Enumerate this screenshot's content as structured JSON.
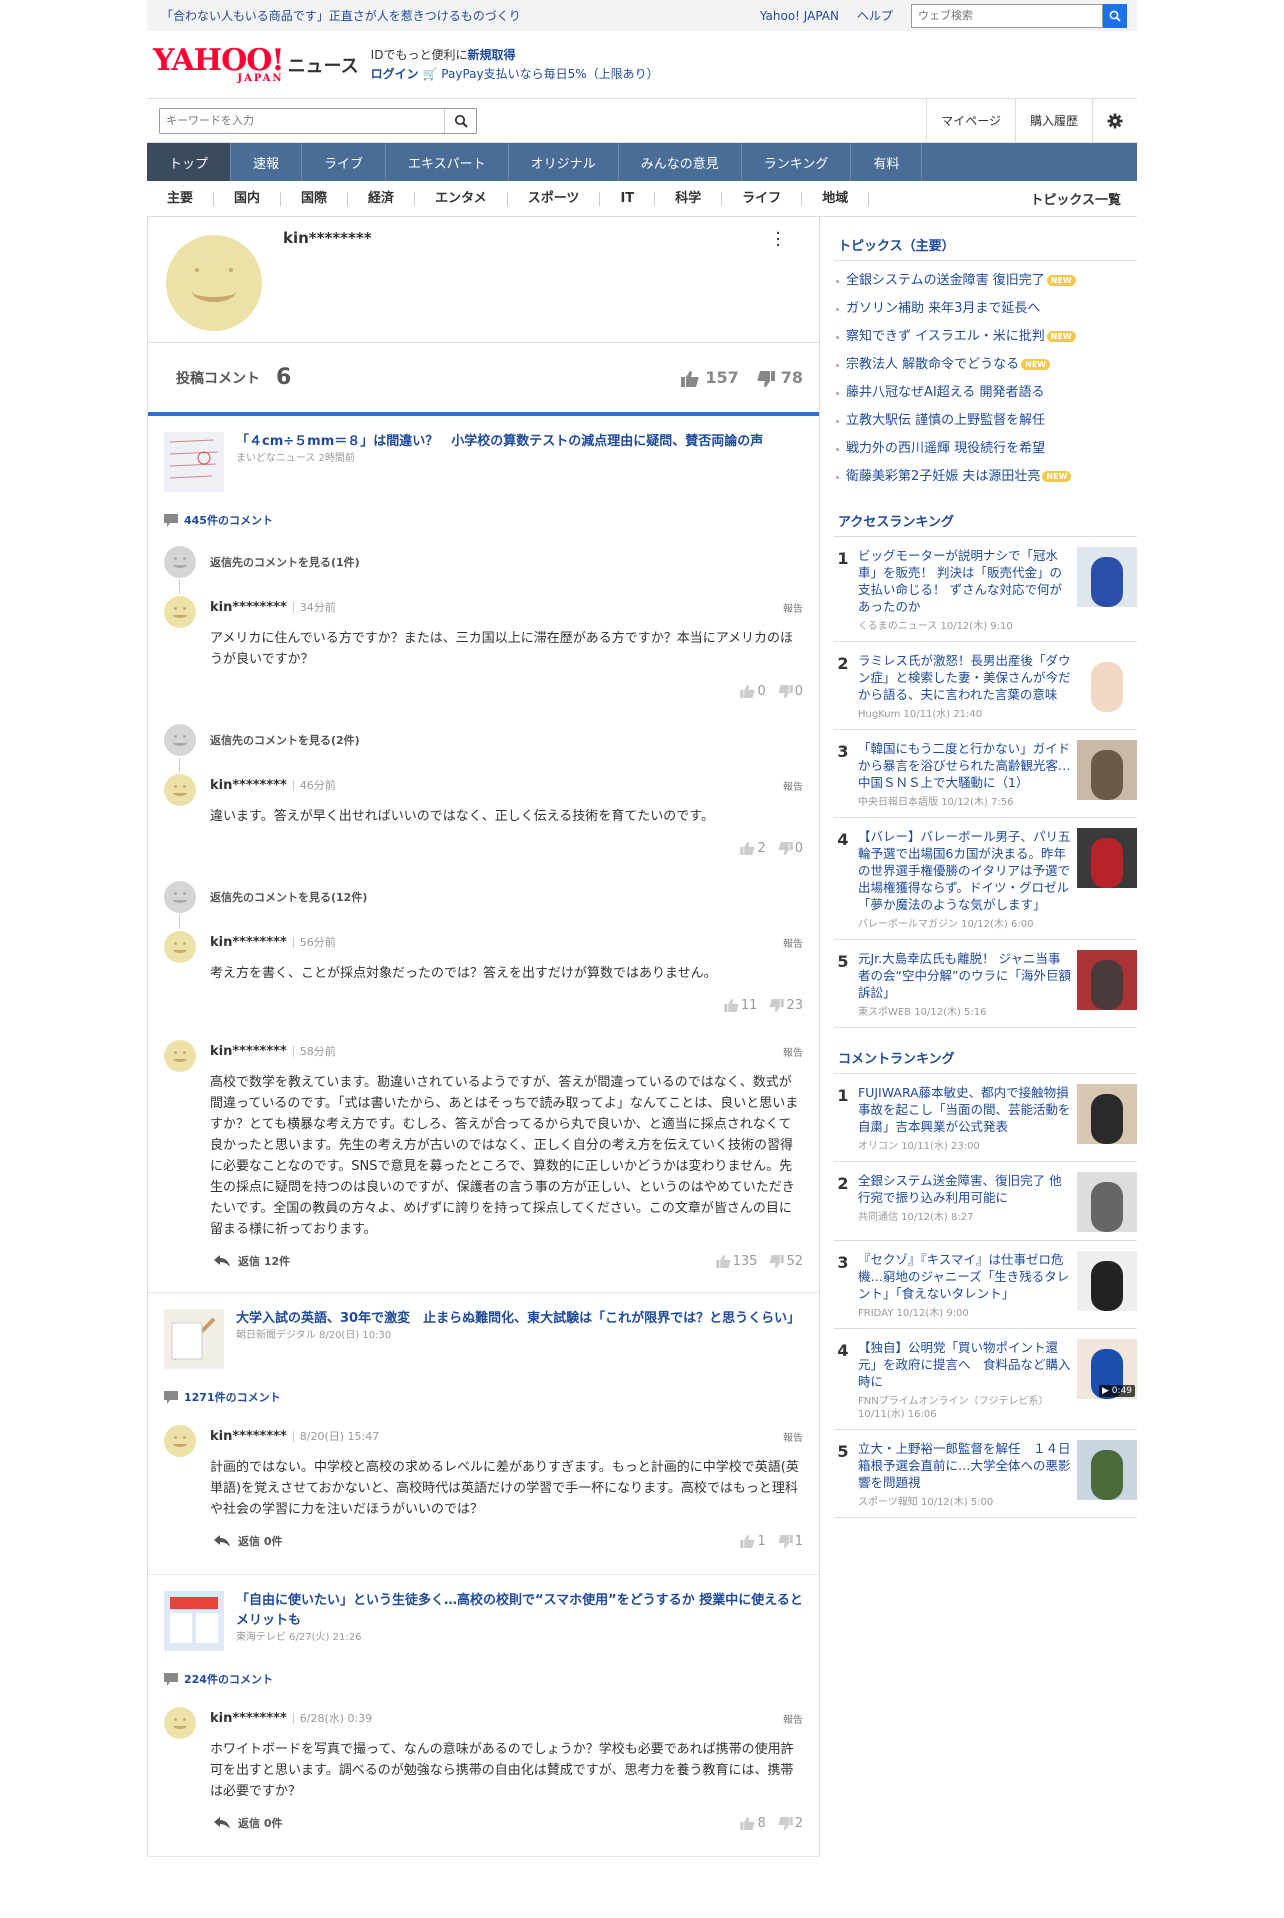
{
  "topbar": {
    "promo": "「合わない人もいる商品です」正直さが人を惹きつけるものづくり",
    "yahoo_link": "Yahoo! JAPAN",
    "help_link": "ヘルプ",
    "web_search_placeholder": "ウェブ検索"
  },
  "header": {
    "logo_text": "YAHOO!",
    "logo_sub": "JAPAN",
    "section": "ニュース",
    "id_text": "IDでもっと便利に",
    "signup": "新規取得",
    "login": "ログイン",
    "paypay": "PayPay支払いなら毎日5%（上限あり）"
  },
  "search": {
    "placeholder": "キーワードを入力",
    "mypage": "マイページ",
    "history": "購入履歴"
  },
  "nav": [
    "トップ",
    "速報",
    "ライブ",
    "エキスパート",
    "オリジナル",
    "みんなの意見",
    "ランキング",
    "有料"
  ],
  "subnav": [
    "主要",
    "国内",
    "国際",
    "経済",
    "エンタメ",
    "スポーツ",
    "IT",
    "科学",
    "ライフ",
    "地域"
  ],
  "subnav_topics": "トピックス一覧",
  "profile": {
    "username": "kin********",
    "comments_label": "投稿コメント",
    "comments_count": "6",
    "likes": "157",
    "dislikes": "78"
  },
  "articles": [
    {
      "title": "「４cm÷５mm＝８」は間違い？　小学校の算数テストの減点理由に疑問、賛否両論の声",
      "source": "まいどなニュース 2時間前",
      "comment_count": "445件のコメント",
      "comments": [
        {
          "reply_link": "返信先のコメントを見る(1件)",
          "user": "kin********",
          "time": "34分前",
          "report": "報告",
          "text": "アメリカに住んでいる方ですか？または、三カ国以上に滞在歴がある方ですか？本当にアメリカのほうが良いですか？",
          "likes": "0",
          "dislikes": "0"
        },
        {
          "reply_link": "返信先のコメントを見る(2件)",
          "user": "kin********",
          "time": "46分前",
          "report": "報告",
          "text": "違います。答えが早く出せればいいのではなく、正しく伝える技術を育てたいのです。",
          "likes": "2",
          "dislikes": "0"
        },
        {
          "reply_link": "返信先のコメントを見る(12件)",
          "user": "kin********",
          "time": "56分前",
          "report": "報告",
          "text": "考え方を書く、ことが採点対象だったのでは？答えを出すだけが算数ではありません。",
          "likes": "11",
          "dislikes": "23"
        },
        {
          "user": "kin********",
          "time": "58分前",
          "report": "報告",
          "text": "高校で数学を教えています。勘違いされているようですが、答えが間違っているのではなく、数式が間違っているのです。「式は書いたから、あとはそっちで読み取ってよ」なんてことは、良いと思いますか？とても横暴な考え方です。むしろ、答えが合ってるから丸で良いか、と適当に採点されなくて良かったと思います。先生の考え方が古いのではなく、正しく自分の考え方を伝えていく技術の習得に必要なことなのです。SNSで意見を募ったところで、算数的に正しいかどうかは変わりません。先生の採点に疑問を持つのは良いのですが、保護者の言う事の方が正しい、というのはやめていただきたいです。全国の教員の方々よ、めげずに誇りを持って採点してください。この文章が皆さんの目に留まる様に祈っております。",
          "reply": "返信 12件",
          "likes": "135",
          "dislikes": "52"
        }
      ]
    },
    {
      "title": "大学入試の英語、30年で激変　止まらぬ難問化、東大試験は「これが限界では？と思うくらい」",
      "source": "朝日新聞デジタル 8/20(日) 10:30",
      "comment_count": "1271件のコメント",
      "comments": [
        {
          "user": "kin********",
          "time": "8/20(日) 15:47",
          "report": "報告",
          "text": "計画的ではない。中学校と高校の求めるレベルに差がありすぎます。もっと計画的に中学校で英語(英単語)を覚えさせておかないと、高校時代は英語だけの学習で手一杯になります。高校ではもっと理科や社会の学習に力を注いだほうがいいのでは？",
          "reply": "返信 0件",
          "likes": "1",
          "dislikes": "1"
        }
      ]
    },
    {
      "title": "「自由に使いたい」という生徒多く…高校の校則で“スマホ使用”をどうするか 授業中に使えるとメリットも",
      "source": "東海テレビ 6/27(火) 21:26",
      "comment_count": "224件のコメント",
      "comments": [
        {
          "user": "kin********",
          "time": "6/28(水) 0:39",
          "report": "報告",
          "text": "ホワイトボードを写真で撮って、なんの意味があるのでしょうか？学校も必要であれば携帯の使用許可を出すと思います。調べるのが勉強なら携帯の自由化は賛成ですが、思考力を養う教育には、携帯は必要ですか？",
          "reply": "返信 0件",
          "likes": "8",
          "dislikes": "2"
        }
      ]
    }
  ],
  "sidebar": {
    "topics_title": "トピックス（主要）",
    "topics": [
      {
        "text": "全銀システムの送金障害 復旧完了",
        "new": "NEW"
      },
      {
        "text": "ガソリン補助 来年3月まで延長へ",
        "new": ""
      },
      {
        "text": "察知できず イスラエル・米に批判",
        "new": "NEW"
      },
      {
        "text": "宗教法人 解散命令でどうなる",
        "new": "NEW"
      },
      {
        "text": "藤井八冠なぜAI超える 開発者語る",
        "new": ""
      },
      {
        "text": "立教大駅伝 謹慎の上野監督を解任",
        "new": ""
      },
      {
        "text": "戦力外の西川遥輝 現役続行を希望",
        "new": ""
      },
      {
        "text": "衛藤美彩第2子妊娠 夫は源田壮亮",
        "new": "NEW"
      }
    ],
    "access_title": "アクセスランキング",
    "access": [
      {
        "rank": "1",
        "title": "ビッグモーターが説明ナシで「冠水車」を販売！ 判決は「販売代金」の支払い命じる！ ずさんな対応で何があったのか",
        "source": "くるまのニュース 10/12(木) 9:10"
      },
      {
        "rank": "2",
        "title": "ラミレス氏が激怒！長男出産後「ダウン症」と検索した妻・美保さんが今だから語る、夫に言われた言葉の意味",
        "source": "HugKum 10/11(水) 21:40"
      },
      {
        "rank": "3",
        "title": "「韓国にもう二度と行かない」ガイドから暴言を浴びせられた高齢観光客…中国ＳＮＳ上で大騒動に（1）",
        "source": "中央日報日本語版 10/12(木) 7:56"
      },
      {
        "rank": "4",
        "title": "【バレー】バレーボール男子、パリ五輪予選で出場国6カ国が決まる。昨年の世界選手権優勝のイタリアは予選で出場権獲得ならず。ドイツ・グロゼル「夢か魔法のような気がします」",
        "source": "バレーボールマガジン 10/12(木) 6:00"
      },
      {
        "rank": "5",
        "title": "元Jr.大島幸広氏も離脱！ ジャニ当事者の会“空中分解”のウラに「海外巨額訴訟」",
        "source": "東スポWEB 10/12(木) 5:16"
      }
    ],
    "comment_title": "コメントランキング",
    "comment_rank": [
      {
        "rank": "1",
        "title": "FUJIWARA藤本敏史、都内で接触物損事故を起こし「当面の間、芸能活動を自粛」吉本興業が公式発表",
        "source": "オリコン 10/11(水) 23:00",
        "badge": ""
      },
      {
        "rank": "2",
        "title": "全銀システム送金障害、復旧完了 他行宛で振り込み利用可能に",
        "source": "共同通信 10/12(木) 8:27",
        "badge": ""
      },
      {
        "rank": "3",
        "title": "『セクゾ』『キスマイ』は仕事ゼロ危機…窮地のジャニーズ「生き残るタレント」「食えないタレント」",
        "source": "FRIDAY 10/12(木) 9:00",
        "badge": ""
      },
      {
        "rank": "4",
        "title": "【独自】公明党「買い物ポイント還元」を政府に提言へ　食料品など購入時に",
        "source": "FNNプライムオンライン（フジテレビ系） 10/11(水) 16:06",
        "badge": "▶ 0:49"
      },
      {
        "rank": "5",
        "title": "立大・上野裕一郎監督を解任　１４日箱根予選会直前に…大学全体への悪影響を問題視",
        "source": "スポーツ報知 10/12(木) 5:00",
        "badge": ""
      }
    ]
  }
}
